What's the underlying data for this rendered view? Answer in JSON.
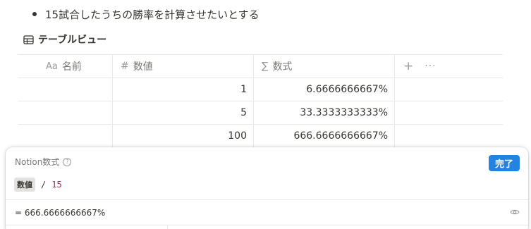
{
  "bullet": {
    "text": "15試合したうちの勝率を計算させたいとする"
  },
  "view": {
    "title": "テーブルビュー",
    "icon": "table-icon"
  },
  "table": {
    "headers": [
      {
        "icon": "text-type-icon",
        "icon_glyph": "Aa",
        "label": "名前"
      },
      {
        "icon": "number-type-icon",
        "icon_glyph": "#",
        "label": "数値"
      },
      {
        "icon": "formula-type-icon",
        "icon_glyph": "∑",
        "label": "数式"
      }
    ],
    "add_glyph": "+",
    "more_glyph": "···",
    "rows": [
      {
        "name": "",
        "value": "1",
        "formula": "6.6666666667%"
      },
      {
        "name": "",
        "value": "5",
        "formula": "33.3333333333%"
      },
      {
        "name": "",
        "value": "100",
        "formula": "666.6666666667%"
      }
    ]
  },
  "formula_panel": {
    "title": "Notion数式",
    "help_glyph": "?",
    "done_label": "完了",
    "token_property": "数値",
    "token_operator": "/",
    "token_literal": "15",
    "result_text": "= 666.6666666667%",
    "accent_color": "#2383e2"
  }
}
